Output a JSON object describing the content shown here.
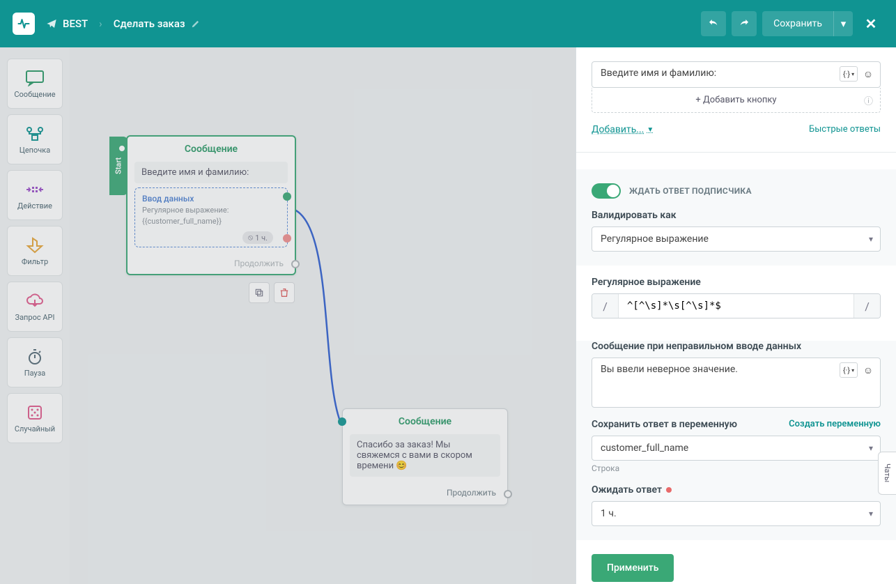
{
  "header": {
    "bot_name": "BEST",
    "flow_name": "Сделать заказ",
    "save_label": "Сохранить"
  },
  "toolbox": {
    "items": [
      {
        "label": "Сообщение",
        "color": "#2a9967"
      },
      {
        "label": "Цепочка",
        "color": "#109492"
      },
      {
        "label": "Действие",
        "color": "#9b4fc9"
      },
      {
        "label": "Фильтр",
        "color": "#e6a53a"
      },
      {
        "label": "Запрос API",
        "color": "#e05a8c"
      },
      {
        "label": "Пауза",
        "color": "#546a76"
      },
      {
        "label": "Случайный",
        "color": "#e05a8c"
      }
    ]
  },
  "canvas": {
    "start_label": "Start",
    "node1": {
      "title": "Сообщение",
      "message": "Введите имя и фамилию:",
      "input_title": "Ввод данных",
      "input_sub1": "Регулярное выражение:",
      "input_sub2": "{{customer_full_name}}",
      "wait_badge": "1 ч.",
      "continue": "Продолжить"
    },
    "node2": {
      "title": "Сообщение",
      "message": "Спасибо за заказ! Мы свяжемся с вами в скором времени 😊",
      "continue": "Продолжить"
    }
  },
  "panel": {
    "msg_value": "Введите имя и фамилию:",
    "add_button": "+ Добавить кнопку",
    "add_link": "Добавить...",
    "quick_replies": "Быстрые ответы",
    "wait_toggle_label": "ЖДАТЬ ОТВЕТ ПОДПИСЧИКА",
    "validate_label": "Валидировать как",
    "validate_value": "Регулярное выражение",
    "regex_label": "Регулярное выражение",
    "regex_value": "^[^\\s]*\\s[^\\s]*$",
    "error_label": "Сообщение при неправильном вводе данных",
    "error_value": "Вы ввели неверное значение.",
    "save_var_label": "Сохранить ответ в переменную",
    "create_var_link": "Создать переменную",
    "var_value": "customer_full_name",
    "var_hint": "Строка",
    "wait_time_label": "Ожидать ответ",
    "wait_time_value": "1 ч.",
    "apply_label": "Применить",
    "chat_tab": "Чаты",
    "vars_btn": "{·}"
  }
}
